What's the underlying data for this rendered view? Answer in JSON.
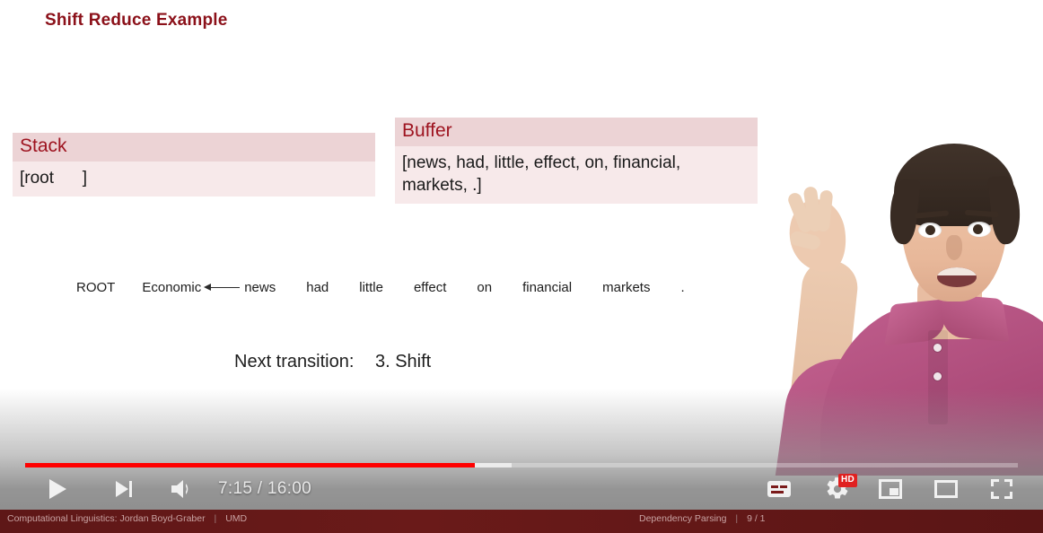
{
  "slide": {
    "title": "Shift Reduce Example",
    "stack": {
      "heading": "Stack",
      "content": "[root      ]"
    },
    "buffer": {
      "heading": "Buffer",
      "content": "[news, had, little, effect, on, financial, markets, .]"
    },
    "sentence": {
      "tokens": [
        "ROOT",
        "Economic",
        "news",
        "had",
        "little",
        "effect",
        "on",
        "financial",
        "markets",
        "."
      ],
      "arc": {
        "from": "news",
        "to": "Economic",
        "direction": "left"
      }
    },
    "transition": {
      "label": "Next transition:",
      "value": "3. Shift"
    },
    "colors": {
      "title": "#8b1019",
      "panel_header_bg": "#ecd3d5",
      "panel_body_bg": "#f7e9ea",
      "panel_header_text": "#9e1420"
    }
  },
  "player": {
    "time": {
      "current": "7:15",
      "total": "16:00",
      "display": "7:15 / 16:00"
    },
    "progress": {
      "played_percent": 45.3,
      "loaded_percent": 49.0,
      "bar_color": "#ff0000"
    },
    "controls": {
      "play": "Play",
      "next": "Next video",
      "volume": "Mute",
      "captions": "Subtitles/closed captions",
      "settings": "Settings",
      "quality_badge": "HD",
      "miniplayer": "Miniplayer",
      "theater": "Theater mode",
      "fullscreen": "Full screen"
    }
  },
  "footer": {
    "left_primary": "Computational Linguistics: Jordan Boyd-Graber",
    "left_separator": "|",
    "left_secondary": "UMD",
    "right_primary": "Dependency Parsing",
    "right_separator": "|",
    "right_secondary": "9 / 1",
    "bg_color": "#5c1616"
  }
}
